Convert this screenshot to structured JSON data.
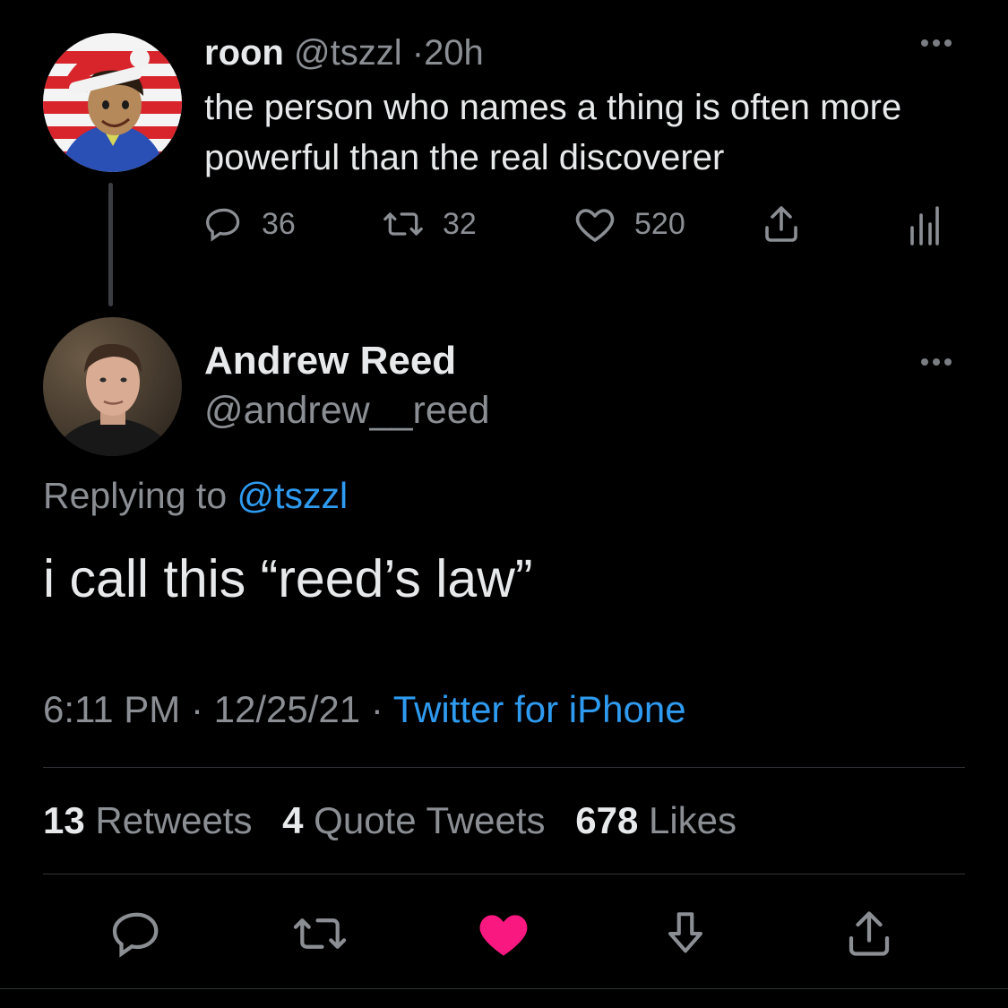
{
  "parent_tweet": {
    "display_name": "roon",
    "handle": "@tszzl",
    "separator": "·",
    "age": "20h",
    "text": "the person who names a thing is often more powerful than the real discoverer",
    "counts": {
      "replies": "36",
      "retweets": "32",
      "likes": "520"
    },
    "icons": [
      "reply-icon",
      "retweet-icon",
      "like-icon",
      "share-icon",
      "analytics-icon",
      "more-icon"
    ]
  },
  "reply_tweet": {
    "display_name": "Andrew Reed",
    "handle": "@andrew__reed",
    "replying_label": "Replying to",
    "replying_handle": "@tszzl",
    "text": "i call this “reed’s law”",
    "time": "6:11 PM",
    "date": "12/25/21",
    "separator": "·",
    "source": "Twitter for iPhone"
  },
  "stats": {
    "retweets_count": "13",
    "retweets_label": "Retweets",
    "quotes_count": "4",
    "quotes_label": "Quote Tweets",
    "likes_count": "678",
    "likes_label": "Likes"
  },
  "bottom_actions": {
    "icons": [
      "reply-icon",
      "retweet-icon",
      "liked-heart-icon",
      "download-icon",
      "share-icon"
    ],
    "liked_color": "#f91880"
  },
  "colors": {
    "background": "#000000",
    "link": "#2f9bf0",
    "muted_text": "#8b8f94",
    "primary_text": "#e7e9ea"
  }
}
